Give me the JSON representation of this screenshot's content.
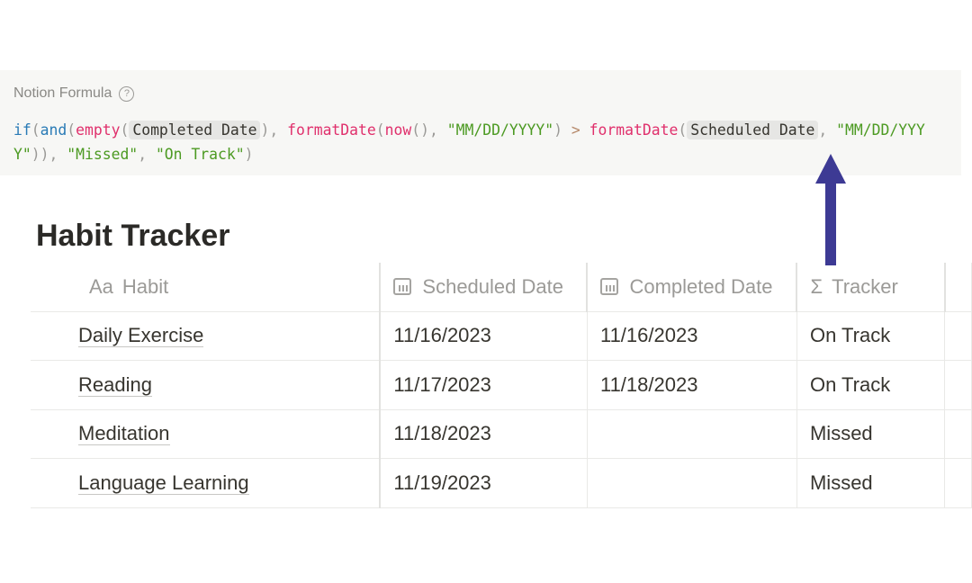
{
  "formula": {
    "label": "Notion Formula",
    "help_icon": "question-circle-icon",
    "tokens": [
      {
        "t": "if",
        "c": "kw"
      },
      {
        "t": "(",
        "c": ""
      },
      {
        "t": "and",
        "c": "kw"
      },
      {
        "t": "(",
        "c": ""
      },
      {
        "t": "empty",
        "c": "fn"
      },
      {
        "t": "(",
        "c": ""
      },
      {
        "t": "Completed Date",
        "c": "prop"
      },
      {
        "t": "), ",
        "c": ""
      },
      {
        "t": "formatDate",
        "c": "fn"
      },
      {
        "t": "(",
        "c": ""
      },
      {
        "t": "now",
        "c": "fn"
      },
      {
        "t": "(), ",
        "c": ""
      },
      {
        "t": "\"MM/DD/YYYY\"",
        "c": "str"
      },
      {
        "t": ") ",
        "c": ""
      },
      {
        "t": ">",
        "c": "op"
      },
      {
        "t": " ",
        "c": ""
      },
      {
        "t": "formatDate",
        "c": "fn"
      },
      {
        "t": "(",
        "c": ""
      },
      {
        "t": "Scheduled Date",
        "c": "prop"
      },
      {
        "t": ", ",
        "c": ""
      },
      {
        "t": "\"MM/DD/YYYY\"",
        "c": "str"
      },
      {
        "t": ")), ",
        "c": ""
      },
      {
        "t": "\"Missed\"",
        "c": "str"
      },
      {
        "t": ", ",
        "c": ""
      },
      {
        "t": "\"On Track\"",
        "c": "str"
      },
      {
        "t": ")",
        "c": ""
      }
    ]
  },
  "arrow_color": "#3d3a94",
  "page_title": "Habit Tracker",
  "table": {
    "headers": [
      {
        "icon": "text-icon",
        "icon_text": "Aa",
        "label": "Habit"
      },
      {
        "icon": "calendar-icon",
        "label": "Scheduled Date"
      },
      {
        "icon": "calendar-icon",
        "label": "Completed Date"
      },
      {
        "icon": "sigma-icon",
        "icon_text": "Σ",
        "label": "Tracker"
      }
    ],
    "rows": [
      [
        "Daily Exercise",
        "11/16/2023",
        "11/16/2023",
        "On Track"
      ],
      [
        "Reading",
        "11/17/2023",
        "11/18/2023",
        "On Track"
      ],
      [
        "Meditation",
        "11/18/2023",
        "",
        "Missed"
      ],
      [
        "Language Learning",
        "11/19/2023",
        "",
        "Missed"
      ]
    ]
  }
}
